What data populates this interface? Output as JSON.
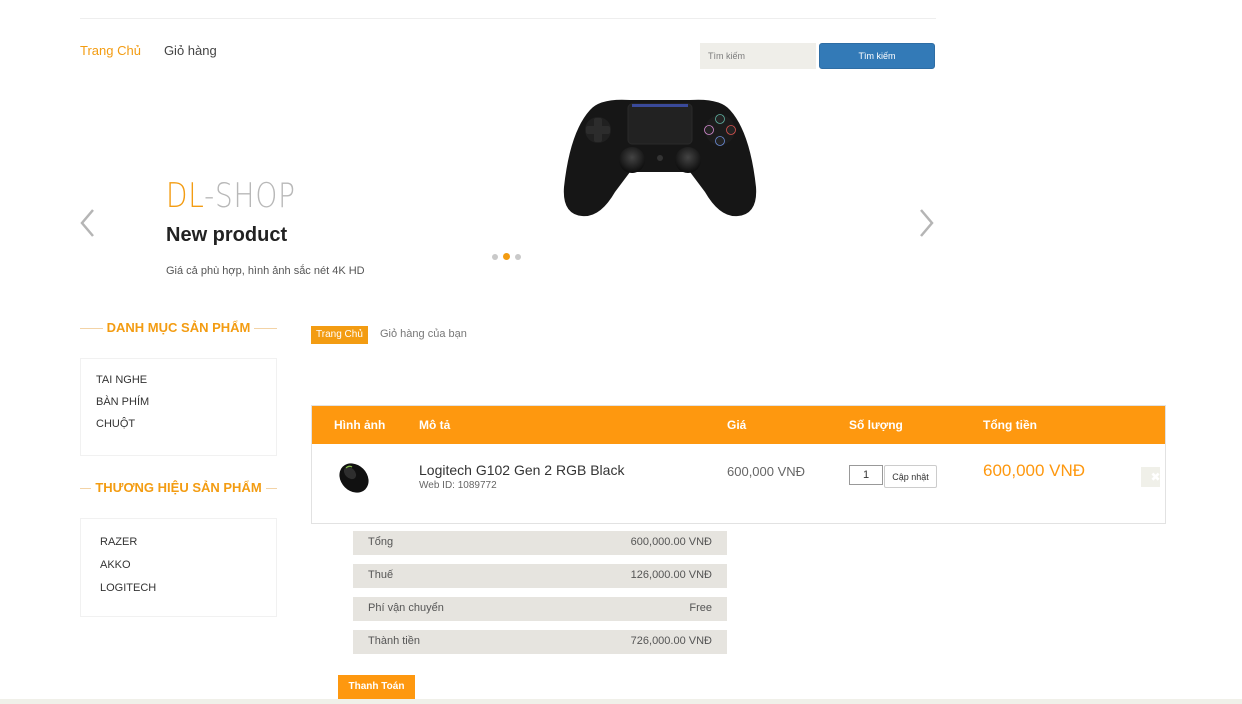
{
  "header": {
    "nav": [
      {
        "label": "Trang Chủ",
        "active": true
      },
      {
        "label": "Giỏ hàng",
        "active": false
      }
    ],
    "search": {
      "placeholder": "Tìm kiếm",
      "button_label": "Tìm kiếm"
    }
  },
  "slider": {
    "brand_part1": "DL",
    "brand_part2": "-SHOP",
    "title": "New product",
    "description": "Giá cả phù hợp, hình ảnh sắc nét 4K HD",
    "product_image": "game-controller-image",
    "dot_count": 3,
    "active_dot": 2
  },
  "sidebar": {
    "categories_heading": "DANH MỤC SẢN PHẨM",
    "categories": [
      "TAI NGHE",
      "BÀN PHÍM",
      "CHUỘT"
    ],
    "brands_heading": "THƯƠNG HIỆU SẢN PHẨM",
    "brands": [
      "RAZER",
      "AKKO",
      "LOGITECH"
    ]
  },
  "breadcrumb": {
    "home": "Trang Chủ",
    "current": "Giỏ hàng của bạn"
  },
  "cart": {
    "headers": [
      "Hình ảnh",
      "Mô tả",
      "Giá",
      "Số lượng",
      "Tổng tiền"
    ],
    "items": [
      {
        "image": "mouse-image",
        "name": "Logitech G102 Gen 2 RGB Black",
        "web_id": "Web ID: 1089772",
        "price": "600,000 VNĐ",
        "quantity": "1",
        "update_label": "Cập nhật",
        "total": "600,000 VNĐ",
        "delete_icon": "close-icon"
      }
    ]
  },
  "totals": [
    {
      "label": "Tổng",
      "value": "600,000.00 VNĐ"
    },
    {
      "label": "Thuế",
      "value": "126,000.00 VNĐ"
    },
    {
      "label": "Phí vận chuyển",
      "value": "Free"
    },
    {
      "label": "Thành tiền",
      "value": "726,000.00 VNĐ"
    }
  ],
  "checkout_label": "Thanh Toán",
  "colors": {
    "accent": "#fe980f",
    "search_button": "#337ab7"
  }
}
